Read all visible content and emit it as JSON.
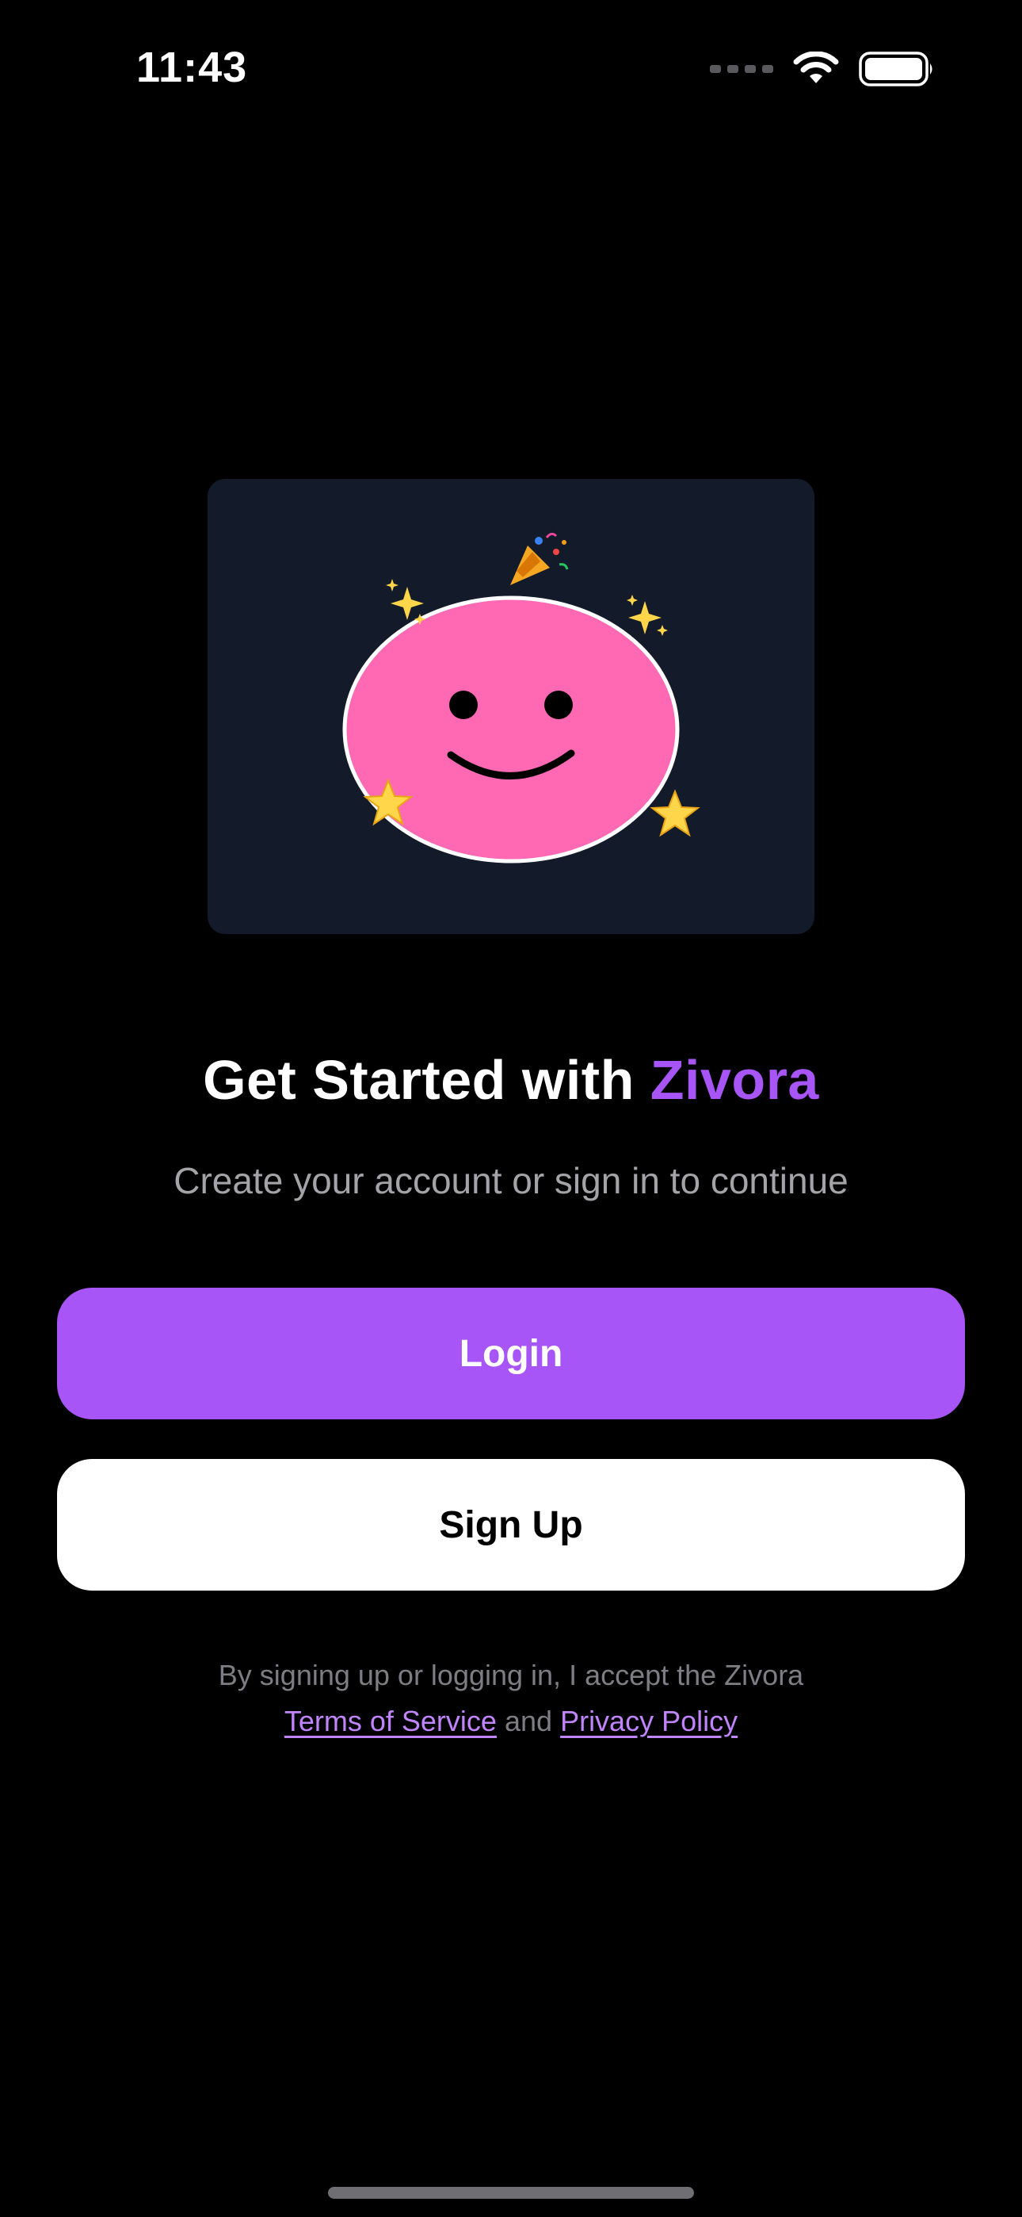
{
  "status_bar": {
    "time": "11:43"
  },
  "hero": {
    "illustration": "smiling-pink-blob-with-party-popper-sparkles-and-stars",
    "colors": {
      "card_background": "#131a29",
      "blob_fill": "#ff69b4",
      "blob_outline": "#ffffff"
    },
    "decorations": [
      "party-popper-icon",
      "sparkles-icon",
      "sparkles-icon",
      "star-icon",
      "star-icon"
    ]
  },
  "headline": {
    "prefix": "Get Started with",
    "brand": "Zivora"
  },
  "subtitle": "Create your account or sign in to continue",
  "buttons": {
    "login_label": "Login",
    "signup_label": "Sign Up"
  },
  "legal": {
    "intro": "By signing up or logging in, I accept the Zivora",
    "terms_label": "Terms of Service",
    "joiner": "and",
    "privacy_label": "Privacy Policy"
  },
  "colors": {
    "background": "#000000",
    "accent": "#a855f7",
    "link": "#c084fc",
    "secondary_text": "#a3a3a8"
  }
}
